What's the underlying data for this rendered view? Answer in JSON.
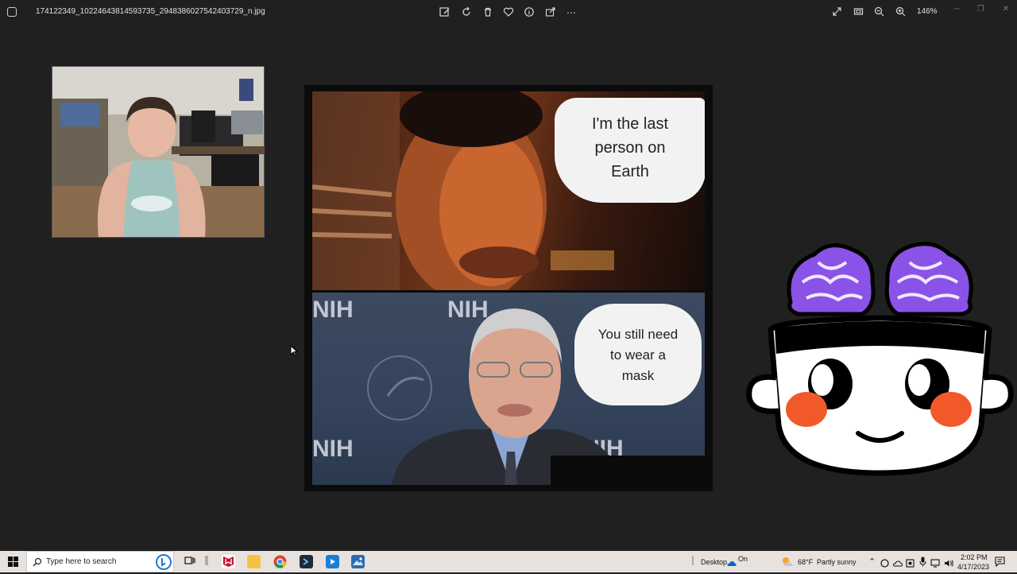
{
  "window": {
    "filename": "174122349_10224643814593735_2948386027542403729_n.jpg",
    "zoom_level": "146%"
  },
  "meme": {
    "top_caption": [
      "I'm the last",
      "person on",
      "Earth"
    ],
    "bottom_caption": [
      "You still need",
      "to wear a",
      "mask"
    ],
    "background_logo_text": "NIH"
  },
  "taskbar": {
    "search_placeholder": "Type here to search",
    "desktop_label": "Desktop",
    "onedrive_status": "On",
    "weather_temp": "68°F",
    "weather_desc": "Partly sunny",
    "time": "2:02 PM",
    "date": "4/17/2023"
  },
  "colors": {
    "background": "#202020",
    "taskbar": "#e8e2de",
    "brain_purple": "#8b52e8",
    "cheek_orange": "#f1592a"
  }
}
